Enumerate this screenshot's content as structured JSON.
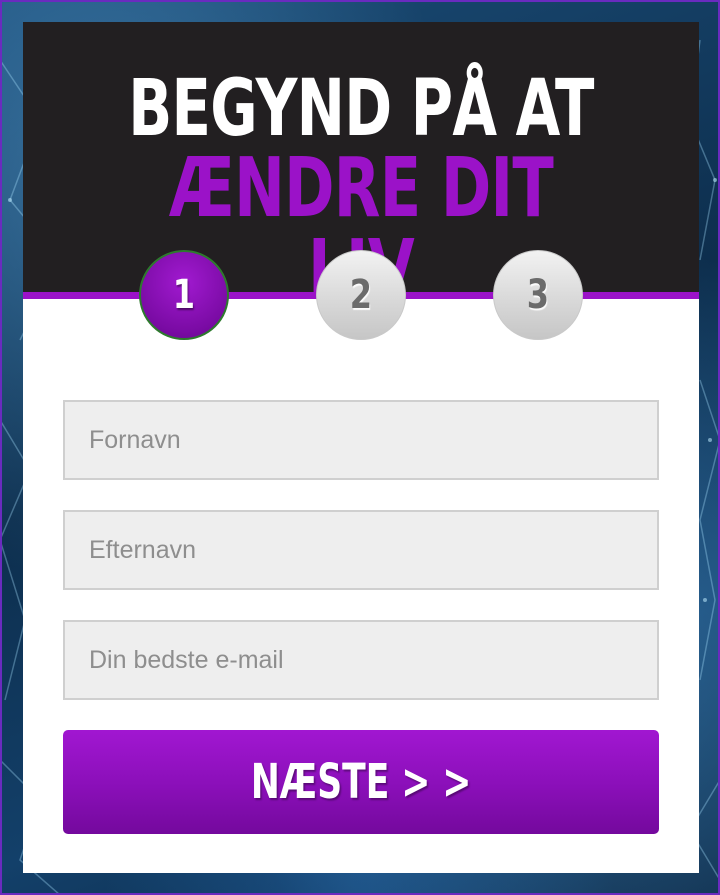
{
  "header": {
    "title_line1": "BEGYND PÅ AT",
    "title_line2": "ÆNDRE DIT LIV"
  },
  "steps": [
    {
      "label": "1",
      "state": "active"
    },
    {
      "label": "2",
      "state": "inactive"
    },
    {
      "label": "3",
      "state": "inactive"
    }
  ],
  "form": {
    "first_name_placeholder": "Fornavn",
    "last_name_placeholder": "Efternavn",
    "email_placeholder": "Din bedste e-mail",
    "next_button_label": "NÆSTE > >"
  },
  "colors": {
    "accent": "#9b12c8",
    "header_bg": "#221f21",
    "field_bg": "#eeeeee"
  }
}
